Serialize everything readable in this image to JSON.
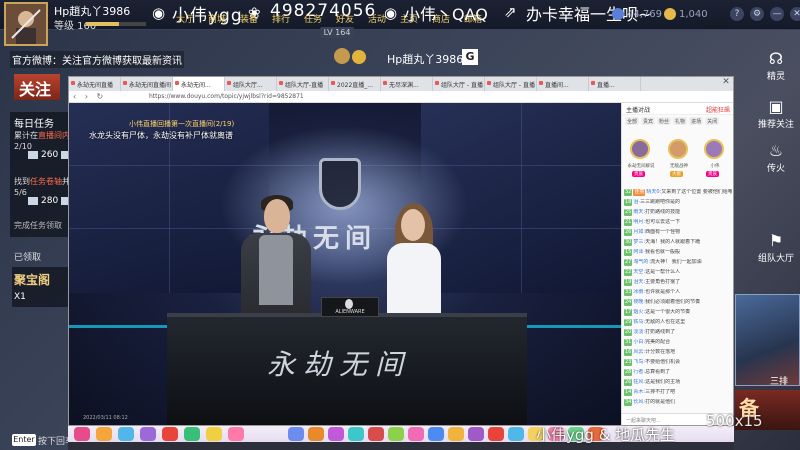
{
  "player": {
    "name": "Hp趙丸丫3986",
    "level": "等级 160"
  },
  "watermark": {
    "name": "小伟ygg",
    "id": "498274056",
    "name2": "小伟丶QAQ",
    "slogan": "办卡幸福一生呗~"
  },
  "top_nav": [
    "大厅",
    "商城",
    "装备",
    "排行",
    "任务",
    "好友",
    "活动",
    "主页",
    "商店",
    "邮箱"
  ],
  "currency": {
    "diamonds": "44,769",
    "gold": "1,040"
  },
  "top_icons": [
    "?",
    "⚙",
    "—",
    "✕"
  ],
  "center": {
    "level_tag": "LV 164",
    "name": "Hp趙丸丫3986",
    "g": "G"
  },
  "left": {
    "official": "官方微博：关注官方微博获取最新资讯",
    "follow": "关注",
    "task_title": "每日任务",
    "task1_pre": "累计在",
    "task1_hl": "直播间内",
    "task1_post": "开播",
    "task1_progress": "2/10",
    "task1_reward_a": "260",
    "task1_reward_b": "1(",
    "task2_pre": "找到",
    "task2_hl": "任务卷轴",
    "task2_post": "并打开",
    "task2_progress": "5/6",
    "task2_reward_a": "280",
    "task2_reward_b": "1(",
    "task_done": "完成任务领取",
    "sold_out": "已领取",
    "treasure_title": "聚宝阁",
    "treasure_count": "X1",
    "enter_key": "Enter",
    "enter_tip": "按下回车"
  },
  "right_menu": [
    {
      "icon": "headphone-icon",
      "glyph": "☊",
      "label": "精灵"
    },
    {
      "icon": "camera-icon",
      "glyph": "▣",
      "label": "推荐关注"
    },
    {
      "icon": "fire-icon",
      "glyph": "♨",
      "label": "传火"
    },
    {
      "icon": "flag-icon",
      "glyph": "⚑",
      "label": "组队大厅"
    }
  ],
  "right_card": {
    "label": "三排",
    "label2": "备"
  },
  "browser": {
    "tabs": [
      "永劫无间直播",
      "永劫无间直播间",
      "永劫无间...",
      "组队大厅...",
      "组队大厅-直播",
      "2022直播_...",
      "无尽深渊...",
      "组队大厅 - 直播",
      "组队大厅 - 直播",
      "直播间...",
      "直播..."
    ],
    "url": "https://www.douyu.com/topic/yjwjlbsl?rid=9852871"
  },
  "video": {
    "marquee": "小伟直播回播第一次直播间(2/19)",
    "danmaku": "水龙头没有尸体，永劫没有补尸体就离谱",
    "logo_text": "永劫无间",
    "desk_logo": "永劫无间",
    "alien": "ALIENWARE",
    "timestamp": "2022/03/11 08:12"
  },
  "chat": {
    "head": "主播对战",
    "head_right": "超能狂飙",
    "tabs": [
      "全部",
      "贵宾",
      "粉丝",
      "礼物",
      "进场",
      "关闭"
    ],
    "ranks": [
      "永劫无间解说",
      "无敌战神",
      "小伟"
    ],
    "rank_tags": [
      "贵族",
      "大佬",
      "贵族"
    ],
    "messages": [
      {
        "lv": "32",
        "fan": "佳丽",
        "nm": "晴天0:",
        "txt": "又来到了这个位置 要被他们给嘲讽了"
      },
      {
        "lv": "18",
        "fan": "",
        "nm": "泪·",
        "txt": "三三跳跑吧你是的"
      },
      {
        "lv": "25",
        "fan": "",
        "nm": "雨天:",
        "txt": "打奶路线的技能"
      },
      {
        "lv": "21",
        "fan": "",
        "nm": "明月:",
        "txt": "也可以去这一下"
      },
      {
        "lv": "26",
        "fan": "",
        "nm": "月如:",
        "txt": "西面有一个怪物"
      },
      {
        "lv": "30",
        "fan": "",
        "nm": "梦三:",
        "txt": "天海！我的人就跟着下跪"
      },
      {
        "lv": "15",
        "fan": "",
        "nm": "阿泽·",
        "txt": "我看也就一般般"
      },
      {
        "lv": "27",
        "fan": "",
        "nm": "淘气的:",
        "txt": "流大神！ 我们一起加油"
      },
      {
        "lv": "22",
        "fan": "",
        "nm": "天空:",
        "txt": "这是一帮什么人"
      },
      {
        "lv": "19",
        "fan": "",
        "nm": "泪天:",
        "txt": "主要角色打猴了"
      },
      {
        "lv": "33",
        "fan": "",
        "nm": "冰雨:",
        "txt": "也许就是那个人"
      },
      {
        "lv": "24",
        "fan": "",
        "nm": "夜晚:",
        "txt": "我们必须跟着他们的节奏"
      },
      {
        "lv": "17",
        "fan": "",
        "nm": "烟火:",
        "txt": "这是一个很大的节奏"
      },
      {
        "lv": "29",
        "fan": "",
        "nm": "铁马:",
        "txt": "无敌的人也在这里"
      },
      {
        "lv": "20",
        "fan": "",
        "nm": "淡淡:",
        "txt": "打奶路线到了"
      },
      {
        "lv": "31",
        "fan": "",
        "nm": "小白:",
        "txt": "完美的配合"
      },
      {
        "lv": "16",
        "fan": "",
        "nm": "风云:",
        "txt": "计分数在落地"
      },
      {
        "lv": "23",
        "fan": "",
        "nm": "飞鸟:",
        "txt": "不要给他们机会"
      },
      {
        "lv": "28",
        "fan": "",
        "nm": "行者:",
        "txt": "总算看到了"
      },
      {
        "lv": "26",
        "fan": "",
        "nm": "狂风:",
        "txt": "这是我们的主场"
      },
      {
        "lv": "14",
        "fan": "",
        "nm": "青木:",
        "txt": "三排不打了吧"
      },
      {
        "lv": "34",
        "fan": "",
        "nm": "长风:",
        "txt": "打的就是他们"
      }
    ],
    "foot": "一起来聊天吧..."
  },
  "gift_colors": [
    "#e64c8c",
    "#f4a53c",
    "#52b6e8",
    "#9b6ad8",
    "#e8443c",
    "#38c07a",
    "#f0d040",
    "#ff7aa8",
    "#6e8cf0",
    "#e88a2c",
    "#c05ad8",
    "#3cc8c8",
    "#d84c4c",
    "#8cd04c",
    "#f06ab4",
    "#4c8cf0",
    "#f0b43c",
    "#a05ac8",
    "#e8443c",
    "#50b8e8",
    "#f4d060",
    "#f080a8",
    "#6ad08c",
    "#e86a3c"
  ],
  "bottom": {
    "watermark": "小伟ygg & 地瓜先生",
    "num": "500x15"
  }
}
